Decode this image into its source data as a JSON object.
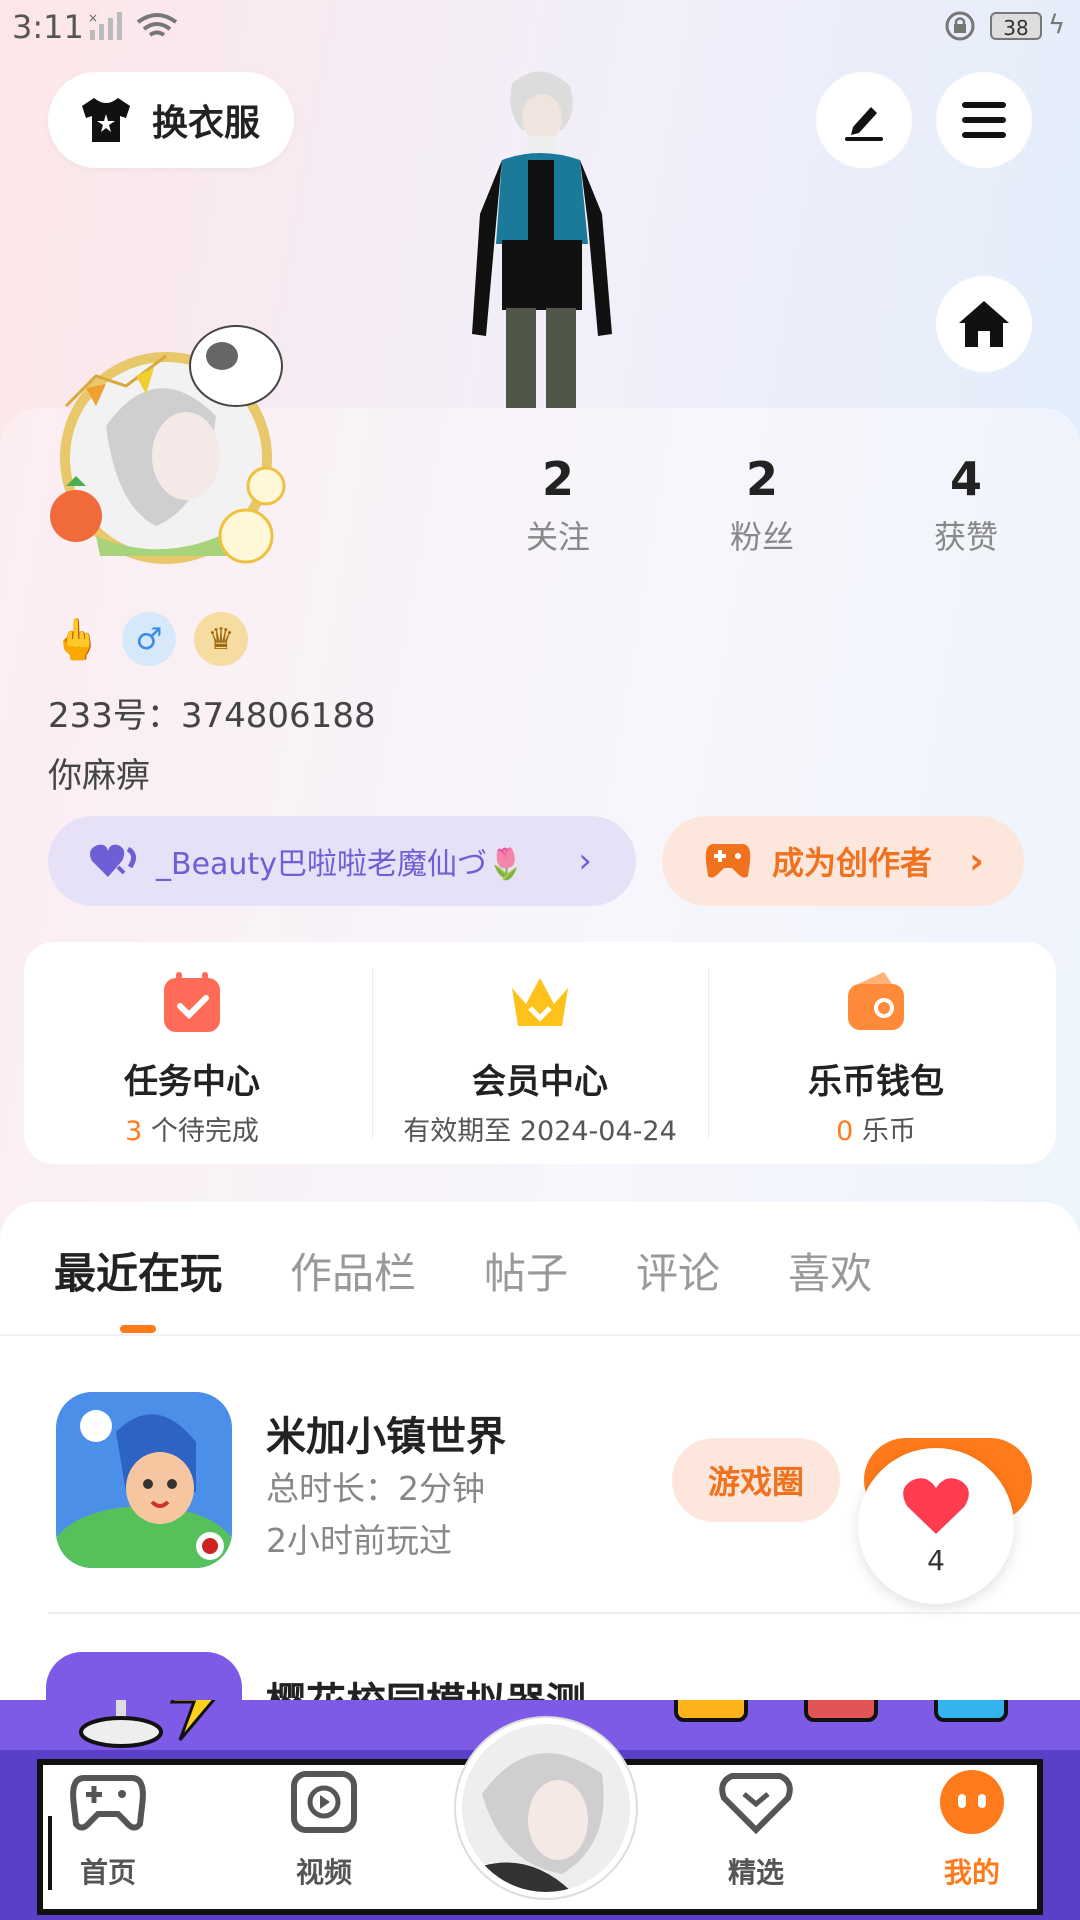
{
  "status_bar": {
    "time": "3:11",
    "battery": "38"
  },
  "top": {
    "outfit_label": "换衣服"
  },
  "profile": {
    "stats": [
      {
        "value": "2",
        "label": "关注"
      },
      {
        "value": "2",
        "label": "粉丝"
      },
      {
        "value": "4",
        "label": "获赞"
      }
    ],
    "uid": "233号：374806188",
    "signature": "你麻痹",
    "group_pill": "_Beauty巴啦啦老魔仙づ🌷",
    "creator_pill": "成为创作者"
  },
  "quick_actions": [
    {
      "title": "任务中心",
      "highlight": "3",
      "rest": " 个待完成"
    },
    {
      "title": "会员中心",
      "highlight": "",
      "rest": "有效期至 2024-04-24"
    },
    {
      "title": "乐币钱包",
      "highlight": "0",
      "rest": " 乐币"
    }
  ],
  "tabs": [
    "最近在玩",
    "作品栏",
    "帖子",
    "评论",
    "喜欢"
  ],
  "games": [
    {
      "title": "米加小镇世界",
      "duration": "总时长：2分钟",
      "last_played": "2小时前玩过",
      "button": "游戏圈"
    },
    {
      "title": "樱花校园模拟器测..."
    }
  ],
  "like_count": "4",
  "bottom_nav": [
    "首页",
    "视频",
    "精选",
    "我的"
  ],
  "colors": {
    "accent": "#ff7a1a",
    "purple": "#6e5fd7",
    "nav_purple": "#5b3fc9"
  }
}
